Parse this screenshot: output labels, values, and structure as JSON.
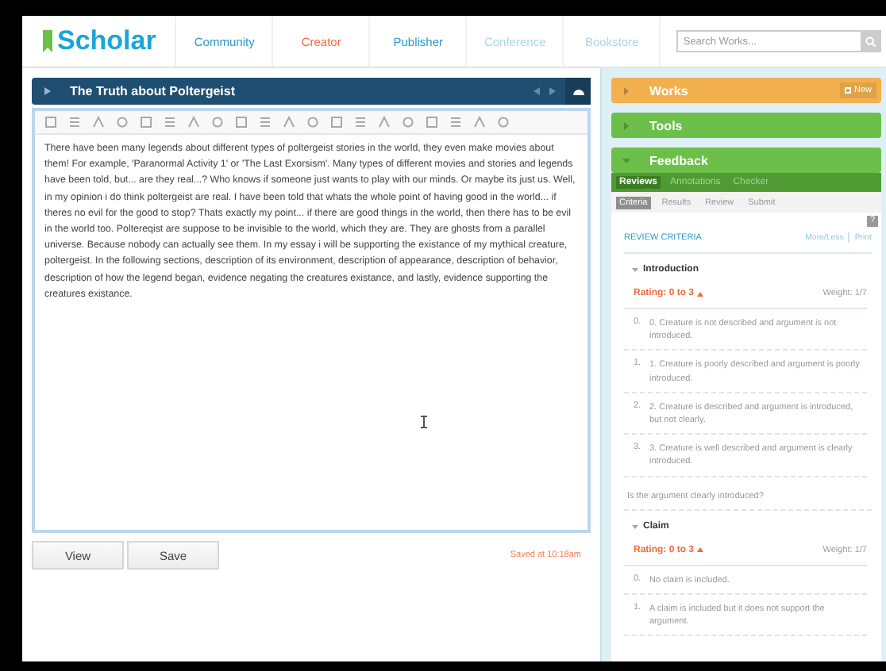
{
  "header": {
    "logo": "Scholar",
    "nav": [
      {
        "label": "Community",
        "selected": false,
        "disabled": false
      },
      {
        "label": "Creator",
        "selected": true,
        "disabled": false
      },
      {
        "label": "Publisher",
        "selected": false,
        "disabled": false
      },
      {
        "label": "Conference",
        "selected": false,
        "disabled": true
      },
      {
        "label": "Bookstore",
        "selected": false,
        "disabled": true
      }
    ],
    "search": {
      "placeholder": "Search Works..."
    }
  },
  "document": {
    "title": "The Truth about Poltergeist",
    "body": "There have been many legends about different types of poltergeist stories in the world, they even make movies about them! For example, 'Paranormal Activity 1' or 'The Last Exorsism'. Many types of different movies and stories and legends have been told, but... are they real...? Who knows if someone just wants to play with our minds. Or maybe its just us. Well, in my opinion i do think poltergeist are real. I have been told that whats the whole point of having good in the world... if theres no evil for the good to stop? Thats exactly my point... if there are good things in the world, then there has to be evil in the world too. Poltereqist are suppose to be invisible to the world, which they are. They are ghosts from a parallel universe. Because nobody can actually see them. In my essay i will be supporting the existance of my mythical creature, poltergeist. In the following sections, description of its environment, description of appearance, description of behavior, description of how the legend began, evidence negating the creatures existance, and lastly, evidence supporting the creatures existance.",
    "buttons": [
      "View",
      "Save"
    ],
    "status": "Saved at 10:18am"
  },
  "sidebar": {
    "panels": [
      {
        "title": "Works",
        "color": "#f2b04e",
        "expanded": false,
        "action": "New"
      },
      {
        "title": "Tools",
        "color": "#6cbf48",
        "expanded": false
      },
      {
        "title": "Feedback",
        "color": "#6cbf48",
        "expanded": true
      }
    ],
    "feedback": {
      "tabs": [
        {
          "label": "Reviews",
          "selected": true
        },
        {
          "label": "Annotations",
          "selected": false
        },
        {
          "label": "Checker",
          "selected": false
        }
      ],
      "subtabs": [
        {
          "label": "Criteria",
          "selected": true
        },
        {
          "label": "Results",
          "selected": false
        },
        {
          "label": "Review",
          "selected": false
        },
        {
          "label": "Submit",
          "selected": false
        }
      ],
      "help": "?",
      "heading": "REVIEW CRITERIA",
      "links": [
        "More/Less",
        "Print"
      ],
      "criteria": [
        {
          "name": "Introduction",
          "expanded": true,
          "rating": "Rating: 0 to 3",
          "weight": "Weight: 1/7",
          "options": [
            {
              "number": "0.",
              "text": "0. Creature is not described and argument is not introduced."
            },
            {
              "number": "1.",
              "text": "1. Creature is poorly described and argument is poorly introduced."
            },
            {
              "number": "2.",
              "text": "2. Creature is described and argument is introduced, but not clearly."
            },
            {
              "number": "3.",
              "text": "3. Creature is well described and argument is clearly introduced."
            }
          ],
          "question": "Is the argument clearly introduced?"
        },
        {
          "name": "Claim",
          "expanded": true,
          "rating": "Rating: 0 to 3",
          "weight": "Weight: 1/7",
          "options": [
            {
              "number": "0.",
              "text": "No claim is included."
            },
            {
              "number": "1.",
              "text": "A claim is included but it does not support the argument."
            }
          ]
        }
      ]
    }
  }
}
